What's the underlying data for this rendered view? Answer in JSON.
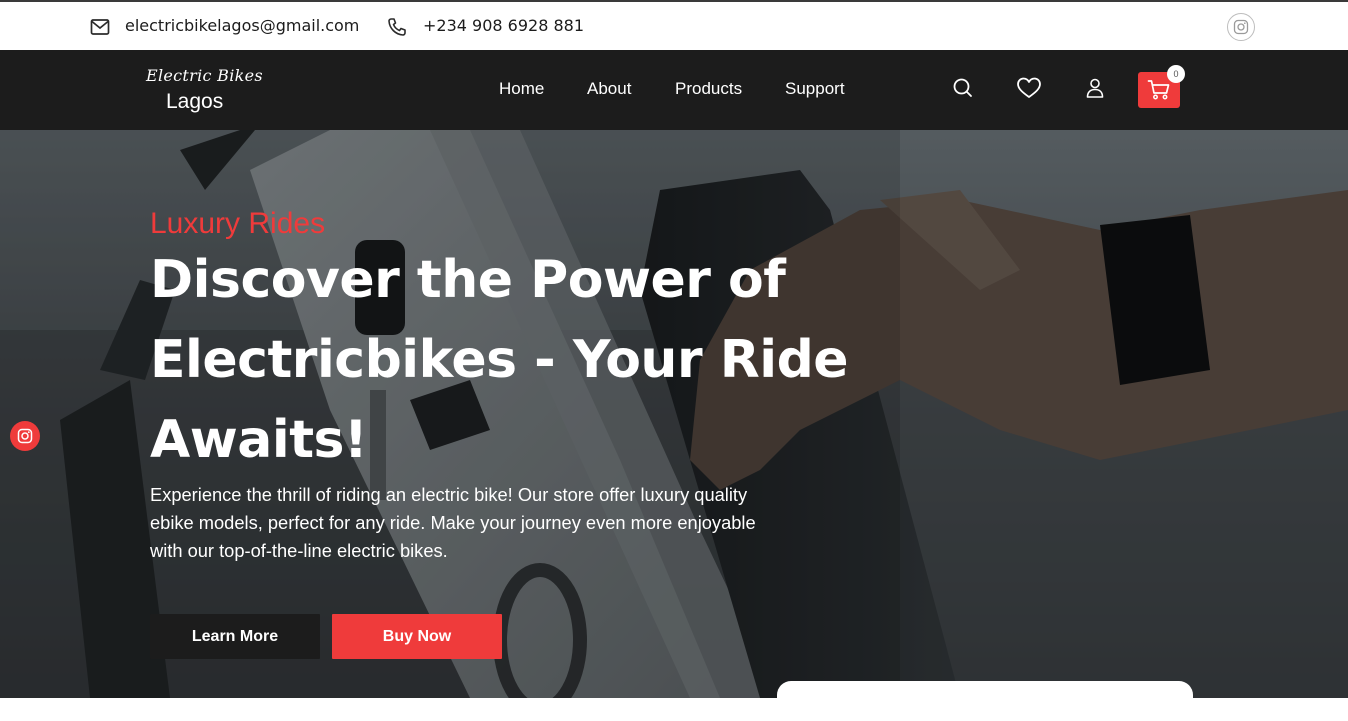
{
  "topbar": {
    "email": "electricbikelagos@gmail.com",
    "phone": "+234 908 6928 881",
    "icons": [
      "mail-icon",
      "phone-icon",
      "instagram-icon"
    ]
  },
  "brand": {
    "script": "Electric Bikes",
    "name": "Lagos"
  },
  "nav": {
    "items": [
      {
        "label": "Home"
      },
      {
        "label": "About"
      },
      {
        "label": "Products"
      },
      {
        "label": "Support"
      }
    ],
    "icons": [
      "search-icon",
      "heart-icon",
      "user-icon",
      "cart-icon"
    ],
    "cart_count": "0"
  },
  "hero": {
    "tagline": "Luxury Rides",
    "headline_line1": "Discover the Power of",
    "headline_line2": "Electricbikes - Your Ride",
    "headline_line3": "Awaits!",
    "description": "Experience the thrill of riding an electric bike! Our store offer luxury quality ebike models, perfect for any ride. Make your journey even more enjoyable with our top-of-the-line electric bikes.",
    "learn_more": "Learn More",
    "buy_now": "Buy Now"
  },
  "colors": {
    "accent": "#ef3b3b",
    "dark": "#1c1c1c",
    "white": "#ffffff"
  }
}
